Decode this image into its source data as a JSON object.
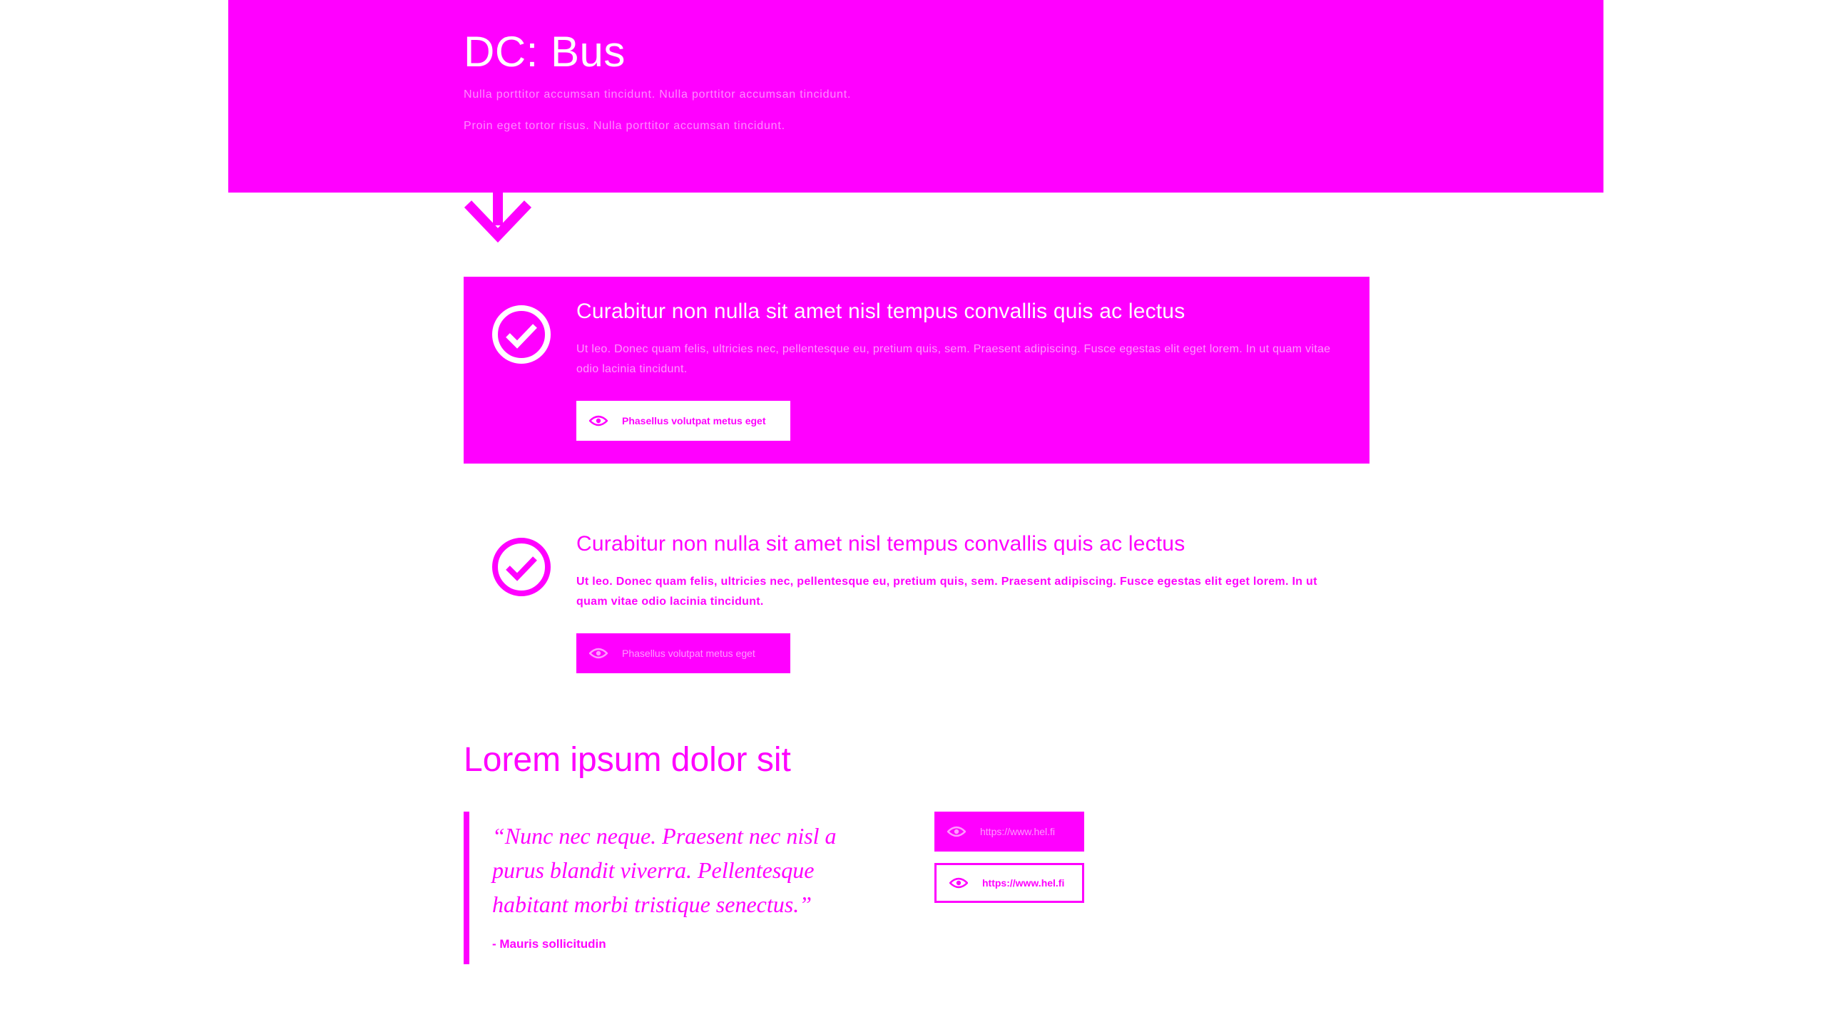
{
  "hero": {
    "title": "DC: Bus",
    "line1": "Nulla porttitor accumsan tincidunt. Nulla porttitor accumsan tincidunt.",
    "line2": "Proin eget tortor risus. Nulla porttitor accumsan tincidunt."
  },
  "cards": [
    {
      "title": "Curabitur non nulla sit amet nisl tempus convallis quis ac lectus",
      "text": "Ut leo. Donec quam felis, ultricies nec, pellentesque eu, pretium quis, sem. Praesent adipiscing. Fusce egestas elit eget lorem. In ut quam vitae odio lacinia tincidunt.",
      "button": "Phasellus volutpat metus eget"
    },
    {
      "title": "Curabitur non nulla sit amet nisl tempus convallis quis ac lectus",
      "text": "Ut leo. Donec quam felis, ultricies nec, pellentesque eu, pretium quis, sem. Praesent adipiscing. Fusce egestas elit eget lorem. In ut quam vitae odio lacinia tincidunt.",
      "button": "Phasellus volutpat metus eget"
    }
  ],
  "section": {
    "title": "Lorem ipsum dolor sit",
    "quote": "“Nunc nec neque. Praesent nec nisl a purus blandit viverra. Pellentesque habitant morbi tristique senectus.”",
    "author": "- Mauris sollicitudin",
    "links": [
      "https://www.hel.fi",
      "https://www.hel.fi"
    ]
  },
  "colors": {
    "brand": "#ff00ff",
    "background": "#ffffff"
  },
  "icons": [
    "arrow-down-icon",
    "check-circle-icon",
    "eye-icon"
  ]
}
